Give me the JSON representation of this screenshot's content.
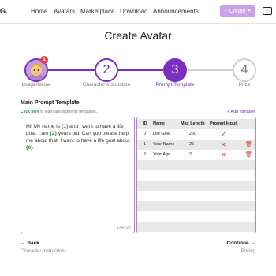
{
  "header": {
    "logo": "G.",
    "nav": [
      "Home",
      "Avatars",
      "Marketplace",
      "Download",
      "Announcements"
    ],
    "create_label": "Create",
    "chat_icon": "chat-bubble-icon",
    "accent": "#c9a3ea"
  },
  "page_title": "Create Avatar",
  "stepper": {
    "steps": [
      {
        "number": "1",
        "label": "Image/Name",
        "state": "completed",
        "badge": "1"
      },
      {
        "number": "2",
        "label": "Character Instruction",
        "state": "completed"
      },
      {
        "number": "3",
        "label": "Prompt Template",
        "state": "active"
      },
      {
        "number": "4",
        "label": "Price",
        "state": "pending"
      }
    ]
  },
  "prompt": {
    "title": "Main Prompt Template",
    "hint_link": "Click here",
    "hint_rest": "to learn about prompt templates.",
    "add_variable": "+ Add variable",
    "parts": [
      {
        "t": "Hi! My name is ",
        "v": false
      },
      {
        "t": "{1}",
        "v": true
      },
      {
        "t": " and i want to have a life goal. I am ",
        "v": false
      },
      {
        "t": "{2}",
        "v": true
      },
      {
        "t": " years old. Can you please help me about that. I want to have a life goal about ",
        "v": false
      },
      {
        "t": "{0}",
        "v": true
      },
      {
        "t": ".",
        "v": false
      }
    ],
    "char_count": "134/223"
  },
  "table": {
    "headers": [
      "ID",
      "Name",
      "Max Length",
      "Prompt Input"
    ],
    "rows": [
      {
        "id": "0",
        "name": "Life Goal",
        "max": "250",
        "input": "check",
        "deletable": false
      },
      {
        "id": "1",
        "name": "Your Name",
        "max": "25",
        "input": "x",
        "deletable": true
      },
      {
        "id": "2",
        "name": "Your Age",
        "max": "2",
        "input": "x",
        "deletable": true
      }
    ]
  },
  "footer": {
    "back_label": "Back",
    "back_sub": "Character Instruction",
    "continue_label": "Continue",
    "continue_sub": "Pricing"
  },
  "colors": {
    "primary": "#7b2fbf",
    "success": "#2a9d48",
    "danger": "#d43c3c"
  }
}
